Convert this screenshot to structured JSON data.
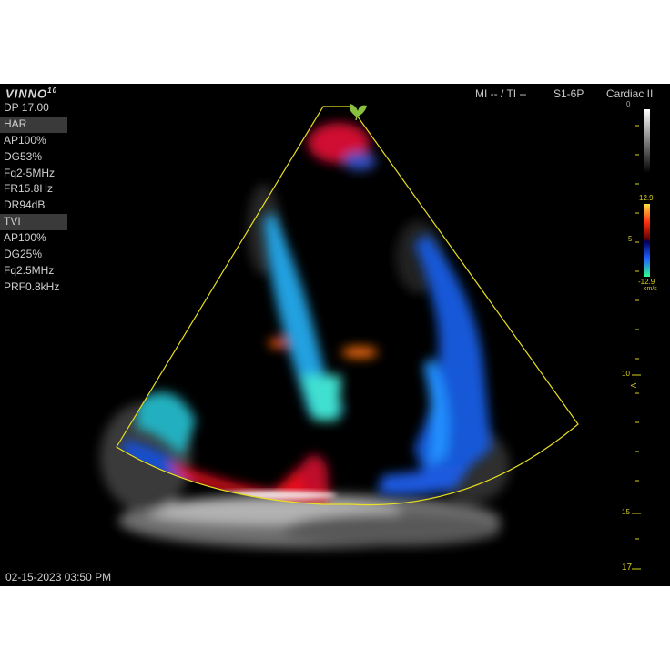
{
  "logo": {
    "text": "VINNO",
    "sup": "10"
  },
  "header": {
    "mi_ti": "MI -- / TI --",
    "probe": "S1-6P",
    "preset": "Cardiac II"
  },
  "params": [
    {
      "label": "DP 17.00",
      "section": false
    },
    {
      "label": "HAR",
      "section": true
    },
    {
      "label": "AP100%",
      "section": false
    },
    {
      "label": "DG53%",
      "section": false
    },
    {
      "label": "Fq2-5MHz",
      "section": false
    },
    {
      "label": "FR15.8Hz",
      "section": false
    },
    {
      "label": "DR94dB",
      "section": false
    },
    {
      "label": "TVI",
      "section": true
    },
    {
      "label": "AP100%",
      "section": false
    },
    {
      "label": "DG25%",
      "section": false
    },
    {
      "label": "Fq2.5MHz",
      "section": false
    },
    {
      "label": "PRF0.8kHz",
      "section": false
    }
  ],
  "datetime": "02-15-2023 03:50 PM",
  "grey_scale": {
    "top": "0"
  },
  "color_scale": {
    "max": "12.9",
    "mid": "5",
    "min": "-12.9",
    "unit": "cm/s"
  },
  "depth_scale": {
    "marks": [
      "10",
      "15",
      "17"
    ],
    "focus_marker": "A"
  },
  "colors": {
    "sector_outline": "#e8e020",
    "background": "#000000",
    "accent": "#d8d020"
  }
}
